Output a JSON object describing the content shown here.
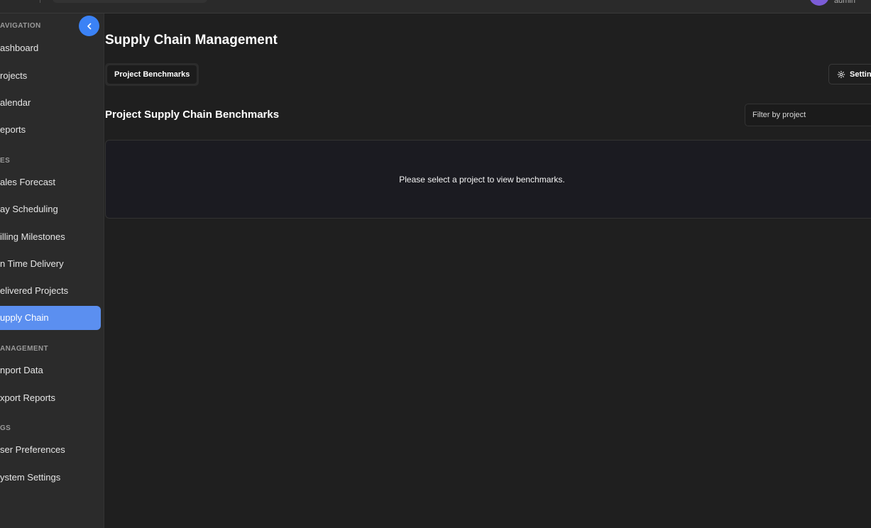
{
  "topbar": {
    "username": "admin"
  },
  "sidebar": {
    "sections": [
      {
        "label": "AVIGATION"
      },
      {
        "label": "ES"
      },
      {
        "label": "ANAGEMENT"
      },
      {
        "label": "GS"
      }
    ],
    "items": [
      {
        "label": "ashboard"
      },
      {
        "label": "rojects"
      },
      {
        "label": "alendar"
      },
      {
        "label": "eports"
      },
      {
        "label": "ales Forecast"
      },
      {
        "label": "ay Scheduling"
      },
      {
        "label": "illing Milestones"
      },
      {
        "label": "n Time Delivery"
      },
      {
        "label": "elivered Projects"
      },
      {
        "label": "upply Chain"
      },
      {
        "label": "nport Data"
      },
      {
        "label": "xport Reports"
      },
      {
        "label": "ser Preferences"
      },
      {
        "label": "ystem Settings"
      }
    ],
    "active_index": 9
  },
  "main": {
    "title": "Supply Chain Management",
    "tabs": [
      {
        "label": "Project Benchmarks"
      }
    ],
    "settings_label": "Settin",
    "section_title": "Project Supply Chain Benchmarks",
    "filter": {
      "placeholder": "Filter by project"
    },
    "empty_message": "Please select a project to view benchmarks."
  },
  "colors": {
    "accent": "#3b82f6",
    "active_item": "#5b8ff0",
    "background": "#1f1f1f",
    "sidebar": "#2b2b2b"
  }
}
